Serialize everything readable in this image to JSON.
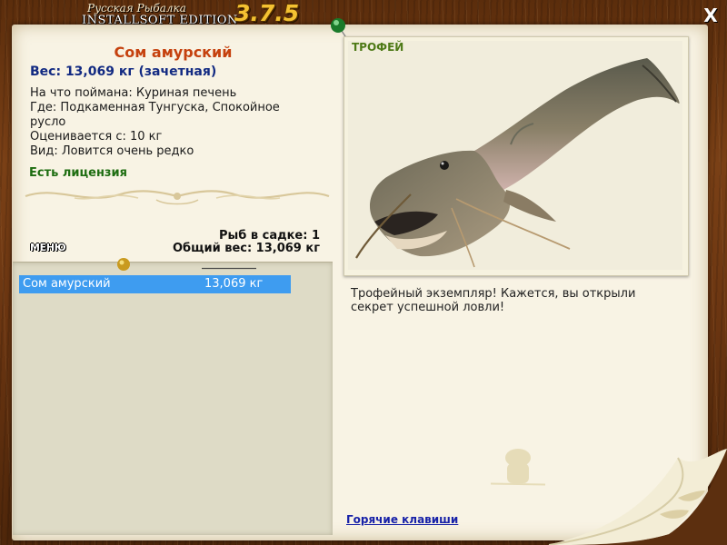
{
  "window": {
    "logo_line1": "Русская Рыбалка",
    "logo_line2": "INSTALLSOFT EDITION",
    "version": "3.7.5",
    "close_glyph": "X"
  },
  "fish": {
    "title": "Сом амурский",
    "weight": "Вес: 13,069 кг (зачетная)",
    "caught_on": "На что поймана: Куриная печень",
    "where": "Где: Подкаменная Тунгуска, Спокойное русло",
    "price": "Оценивается с: 10 кг",
    "kind": "Вид: Ловится очень редко",
    "license": "Есть лицензия"
  },
  "summary": {
    "fish_count": "Рыб в садке: 1",
    "total_weight": "Общий вес: 13,069 кг"
  },
  "menu_label": "МЕНЮ",
  "catch_list": [
    {
      "name": "Сом амурский",
      "weight": "13,069 кг"
    }
  ],
  "trophy": {
    "label": "ТРОФЕЙ",
    "message": "Трофейный экземпляр! Кажется, вы открыли секрет успешной ловли!"
  },
  "hotkeys_link": "Горячие клавиши",
  "colors": {
    "selection": "#3e9cf0",
    "title": "#c5410e",
    "weight": "#122a82",
    "license": "#1e6d11",
    "trophy_label": "#4e7a17",
    "link": "#1822a8"
  },
  "icons": {
    "close": "close-icon",
    "pushpin": "green-pushpin-icon",
    "pin": "yellow-pin-icon"
  }
}
